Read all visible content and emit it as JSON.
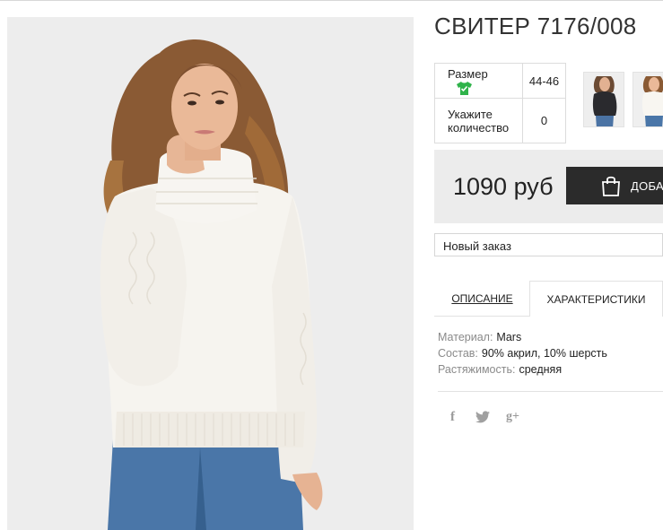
{
  "product": {
    "title": "СВИТЕР 7176/008",
    "main_image_icon": "model-white-sweater-photo",
    "thumbnails": [
      {
        "icon": "model-dark-sweater-thumbnail"
      },
      {
        "icon": "model-white-sweater-thumbnail"
      }
    ]
  },
  "options": {
    "size_label": "Размер",
    "size_icon": "tshirt-size-icon",
    "size_value": "44-46",
    "qty_label_line1": "Укажите",
    "qty_label_line2": "количество",
    "qty_value": "0"
  },
  "purchase": {
    "price": "1090 руб",
    "add_button_label": "ДОБАВИТЬ В КОРЗИНУ",
    "add_button_icon": "shopping-bag-icon"
  },
  "order_select": {
    "selected": "Новый заказ"
  },
  "tabs": {
    "description": "ОПИСАНИЕ",
    "specifications": "ХАРАКТЕРИСТИКИ",
    "active": "specifications"
  },
  "specs": [
    {
      "key": "Материал:",
      "value": "Mars"
    },
    {
      "key": "Состав:",
      "value": "90% акрил, 10% шерсть"
    },
    {
      "key": "Растяжимость:",
      "value": "средняя"
    }
  ],
  "social": {
    "facebook": "f",
    "twitter": "twitter-bird-icon",
    "googleplus": "g+"
  },
  "colors": {
    "accent_green": "#2fb34a",
    "button_dark": "#2b2b2b",
    "price_bar_bg": "#ececec",
    "photo_bg": "#ededed",
    "sweater": "#f5f3ee",
    "jeans": "#3f6d9e"
  }
}
